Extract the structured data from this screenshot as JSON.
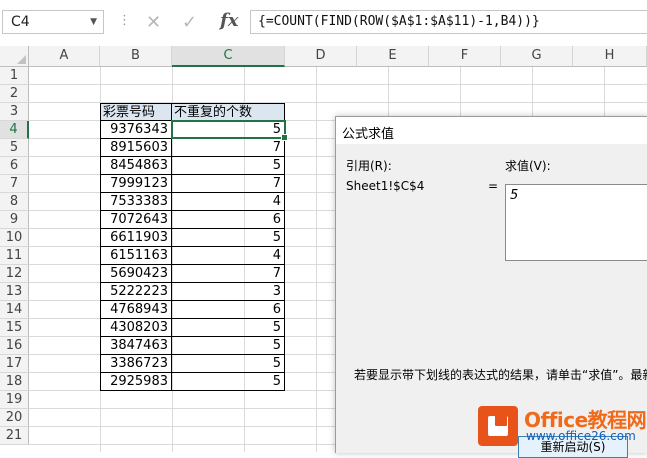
{
  "formula_bar": {
    "name_box": "C4",
    "formula": "{=COUNT(FIND(ROW($A$1:$A$11)-1,B4))}",
    "cancel_icon": "x-icon",
    "enter_icon": "check-icon",
    "fx_label": "fx"
  },
  "columns": [
    "A",
    "B",
    "C",
    "D",
    "E",
    "F",
    "G",
    "H"
  ],
  "rows": [
    "1",
    "2",
    "3",
    "4",
    "5",
    "6",
    "7",
    "8",
    "9",
    "10",
    "11",
    "12",
    "13",
    "14",
    "15",
    "16",
    "17",
    "18",
    "19",
    "20",
    "21"
  ],
  "table": {
    "header_b": "彩票号码",
    "header_c": "不重复的个数",
    "b": [
      "9376343",
      "8915603",
      "8454863",
      "7999123",
      "7533383",
      "7072643",
      "6611903",
      "6151163",
      "5690423",
      "5222223",
      "4768943",
      "4308203",
      "3847463",
      "3386723",
      "2925983"
    ],
    "c": [
      "5",
      "7",
      "5",
      "7",
      "4",
      "6",
      "5",
      "4",
      "7",
      "3",
      "6",
      "5",
      "5",
      "5",
      "5"
    ]
  },
  "dialog": {
    "title": "公式求值",
    "ref_label": "引用(R):",
    "ref_value": "Sheet1!$C$4",
    "eq": "=",
    "eval_label": "求值(V):",
    "eval_value": "5",
    "hint": "若要显示带下划线的表达式的结果，请单击“求值”。最新",
    "restart_button": "重新启动(S)"
  },
  "watermark": {
    "line1": "Office教程网",
    "line2": "www.office26.com"
  }
}
